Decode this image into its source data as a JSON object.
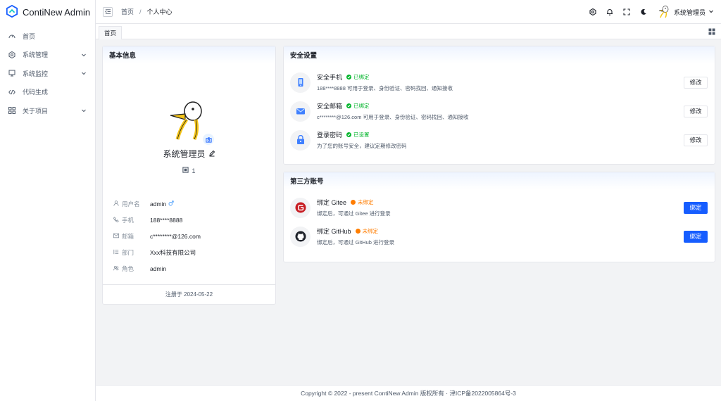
{
  "app": {
    "title": "ContiNew Admin",
    "accent": "#165dff"
  },
  "sidebar": {
    "items": [
      {
        "label": "首页",
        "icon": "dashboard-icon",
        "expandable": false
      },
      {
        "label": "系统管理",
        "icon": "settings-icon",
        "expandable": true
      },
      {
        "label": "系统监控",
        "icon": "monitor-icon",
        "expandable": true
      },
      {
        "label": "代码生成",
        "icon": "code-icon",
        "expandable": false
      },
      {
        "label": "关于项目",
        "icon": "apps-icon",
        "expandable": true
      }
    ]
  },
  "header": {
    "breadcrumb": [
      "首页",
      "个人中心"
    ],
    "breadcrumb_sep": "/",
    "user_name": "系统管理员"
  },
  "tabs": [
    {
      "label": "首页"
    }
  ],
  "profile": {
    "title": "基本信息",
    "nickname": "系统管理员",
    "dept_count": "1",
    "fields": [
      {
        "label": "用户名",
        "value": "admin",
        "icon": "user-icon"
      },
      {
        "label": "手机",
        "value": "188****8888",
        "icon": "phone-icon"
      },
      {
        "label": "邮箱",
        "value": "c********@126.com",
        "icon": "email-icon"
      },
      {
        "label": "部门",
        "value": "Xxx科技有限公司",
        "icon": "dept-icon"
      },
      {
        "label": "角色",
        "value": "admin",
        "icon": "role-icon"
      }
    ],
    "register_text": "注册于 2024-05-22"
  },
  "security": {
    "title": "安全设置",
    "items": [
      {
        "title": "安全手机",
        "status": "已绑定",
        "status_color": "#00b42a",
        "desc": "188****8888 可用于登录、身份验证、密码找回、通知接收",
        "action": "修改",
        "icon": "phone-icon"
      },
      {
        "title": "安全邮箱",
        "status": "已绑定",
        "status_color": "#00b42a",
        "desc": "c********@126.com 可用于登录、身份验证、密码找回、通知接收",
        "action": "修改",
        "icon": "email-icon"
      },
      {
        "title": "登录密码",
        "status": "已设置",
        "status_color": "#00b42a",
        "desc": "为了您的账号安全，建议定期修改密码",
        "action": "修改",
        "icon": "lock-icon"
      }
    ]
  },
  "third_party": {
    "title": "第三方账号",
    "items": [
      {
        "title": "绑定 Gitee",
        "status": "未绑定",
        "status_color": "#ff7d00",
        "desc": "绑定后，可通过 Gitee 进行登录",
        "action": "绑定",
        "icon": "gitee-icon"
      },
      {
        "title": "绑定 GitHub",
        "status": "未绑定",
        "status_color": "#ff7d00",
        "desc": "绑定后，可通过 GitHub 进行登录",
        "action": "绑定",
        "icon": "github-icon"
      }
    ]
  },
  "footer": {
    "text": "Copyright © 2022 - present ContiNew Admin 版权所有 · 津ICP备2022005864号-3"
  }
}
